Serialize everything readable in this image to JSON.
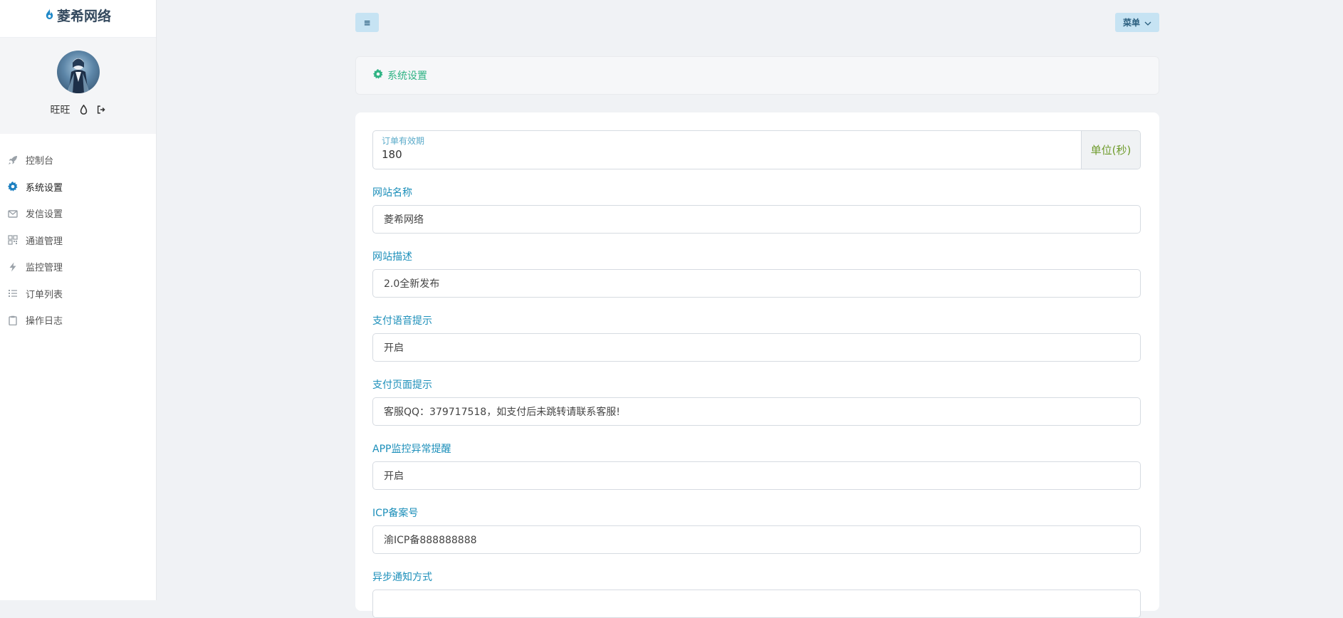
{
  "brand": {
    "name": "菱希网络"
  },
  "user": {
    "name": "旺旺"
  },
  "sidebar": {
    "items": [
      {
        "label": "控制台",
        "icon": "rocket-icon"
      },
      {
        "label": "系统设置",
        "icon": "gear-icon",
        "active": true
      },
      {
        "label": "发信设置",
        "icon": "envelope-icon"
      },
      {
        "label": "通道管理",
        "icon": "qrcode-icon"
      },
      {
        "label": "监控管理",
        "icon": "bolt-icon"
      },
      {
        "label": "订单列表",
        "icon": "list-icon"
      },
      {
        "label": "操作日志",
        "icon": "clipboard-icon"
      }
    ]
  },
  "topbar": {
    "hamburger_label": "≡",
    "menu_label": "菜单"
  },
  "breadcrumb": {
    "title": "系统设置"
  },
  "form": {
    "order_validity": {
      "label": "订单有效期",
      "value": "180",
      "unit": "单位(秒)"
    },
    "fields": [
      {
        "label": "网站名称",
        "value": "菱希网络"
      },
      {
        "label": "网站描述",
        "value": "2.0全新发布"
      },
      {
        "label": "支付语音提示",
        "value": "开启"
      },
      {
        "label": "支付页面提示",
        "value": "客服QQ：379717518，如支付后未跳转请联系客服!"
      },
      {
        "label": "APP监控异常提醒",
        "value": "开启"
      },
      {
        "label": "ICP备案号",
        "value": "渝ICP备888888888"
      },
      {
        "label": "异步通知方式",
        "value": ""
      }
    ]
  },
  "colors": {
    "accent": "#1c8fba",
    "breadcrumb": "#2fb384",
    "unit": "#6e9b2b",
    "button_bg": "#c6e3f3"
  }
}
